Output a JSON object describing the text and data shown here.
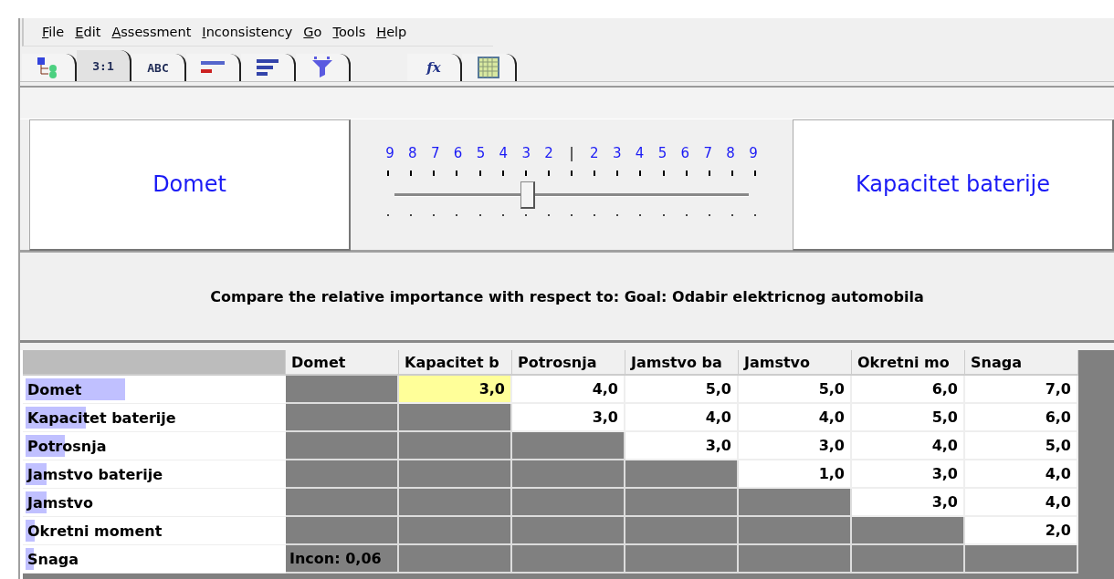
{
  "menu": [
    "File",
    "Edit",
    "Assessment",
    "Inconsistency",
    "Go",
    "Tools",
    "Help"
  ],
  "tabs": [
    {
      "kind": "tree",
      "selected": false
    },
    {
      "kind": "text",
      "label": "3:1",
      "selected": true
    },
    {
      "kind": "text",
      "label": "ABC",
      "selected": false
    },
    {
      "kind": "bars-two",
      "selected": false
    },
    {
      "kind": "bars",
      "selected": false
    },
    {
      "kind": "funnel",
      "selected": false
    },
    {
      "kind": "formula",
      "label": "fx",
      "selected": false
    },
    {
      "kind": "grid",
      "selected": false
    }
  ],
  "comparison": {
    "left": "Domet",
    "right": "Kapacitet baterije",
    "level": 0.375,
    "scale": [
      {
        "label": "9",
        "kind": "number"
      },
      {
        "label": "8",
        "kind": "number"
      },
      {
        "label": "7",
        "kind": "number"
      },
      {
        "label": "6",
        "kind": "number"
      },
      {
        "label": "5",
        "kind": "number"
      },
      {
        "label": "4",
        "kind": "number"
      },
      {
        "label": "3",
        "kind": "number"
      },
      {
        "label": "2",
        "kind": "number"
      },
      {
        "label": "|",
        "kind": "divider"
      },
      {
        "label": "2",
        "kind": "number"
      },
      {
        "label": "3",
        "kind": "number"
      },
      {
        "label": "4",
        "kind": "number"
      },
      {
        "label": "5",
        "kind": "number"
      },
      {
        "label": "6",
        "kind": "number"
      },
      {
        "label": "7",
        "kind": "number"
      },
      {
        "label": "8",
        "kind": "number"
      },
      {
        "label": "9",
        "kind": "number"
      }
    ]
  },
  "instruction": "Compare the relative importance with respect to: Goal: Odabir elektricnog automobila",
  "table": {
    "columns": [
      "Domet",
      "Kapacitet b",
      "Potrosnja",
      "Jamstvo ba",
      "Jamstvo",
      "Okretni mo",
      "Snaga"
    ],
    "rows": [
      {
        "label": "Domet",
        "level": 0.38,
        "cells": [
          {
            "kind": "blank"
          },
          {
            "kind": "value",
            "text": "3,0",
            "selected": true
          },
          {
            "kind": "value",
            "text": "4,0",
            "selected": false
          },
          {
            "kind": "value",
            "text": "5,0",
            "selected": false
          },
          {
            "kind": "value",
            "text": "5,0",
            "selected": false
          },
          {
            "kind": "value",
            "text": "6,0",
            "selected": false
          },
          {
            "kind": "value",
            "text": "7,0",
            "selected": false
          }
        ]
      },
      {
        "label": "Kapacitet baterije",
        "level": 0.23,
        "cells": [
          {
            "kind": "blank"
          },
          {
            "kind": "blank"
          },
          {
            "kind": "value",
            "text": "3,0",
            "selected": false
          },
          {
            "kind": "value",
            "text": "4,0",
            "selected": false
          },
          {
            "kind": "value",
            "text": "4,0",
            "selected": false
          },
          {
            "kind": "value",
            "text": "5,0",
            "selected": false
          },
          {
            "kind": "value",
            "text": "6,0",
            "selected": false
          }
        ]
      },
      {
        "label": "Potrosnja",
        "level": 0.15,
        "cells": [
          {
            "kind": "blank"
          },
          {
            "kind": "blank"
          },
          {
            "kind": "blank"
          },
          {
            "kind": "value",
            "text": "3,0",
            "selected": false
          },
          {
            "kind": "value",
            "text": "3,0",
            "selected": false
          },
          {
            "kind": "value",
            "text": "4,0",
            "selected": false
          },
          {
            "kind": "value",
            "text": "5,0",
            "selected": false
          }
        ]
      },
      {
        "label": "Jamstvo baterije",
        "level": 0.08,
        "cells": [
          {
            "kind": "blank"
          },
          {
            "kind": "blank"
          },
          {
            "kind": "blank"
          },
          {
            "kind": "blank"
          },
          {
            "kind": "value",
            "text": "1,0",
            "selected": false
          },
          {
            "kind": "value",
            "text": "3,0",
            "selected": false
          },
          {
            "kind": "value",
            "text": "4,0",
            "selected": false
          }
        ]
      },
      {
        "label": "Jamstvo",
        "level": 0.08,
        "cells": [
          {
            "kind": "blank"
          },
          {
            "kind": "blank"
          },
          {
            "kind": "blank"
          },
          {
            "kind": "blank"
          },
          {
            "kind": "blank"
          },
          {
            "kind": "value",
            "text": "3,0",
            "selected": false
          },
          {
            "kind": "value",
            "text": "4,0",
            "selected": false
          }
        ]
      },
      {
        "label": "Okretni moment",
        "level": 0.035,
        "cells": [
          {
            "kind": "blank"
          },
          {
            "kind": "blank"
          },
          {
            "kind": "blank"
          },
          {
            "kind": "blank"
          },
          {
            "kind": "blank"
          },
          {
            "kind": "blank"
          },
          {
            "kind": "value",
            "text": "2,0",
            "selected": false
          }
        ]
      },
      {
        "label": "Snaga",
        "level": 0.03,
        "cells": [
          {
            "kind": "note",
            "text": "Incon: 0,06"
          },
          {
            "kind": "blank"
          },
          {
            "kind": "blank"
          },
          {
            "kind": "blank"
          },
          {
            "kind": "blank"
          },
          {
            "kind": "blank"
          },
          {
            "kind": "blank"
          }
        ]
      }
    ]
  }
}
